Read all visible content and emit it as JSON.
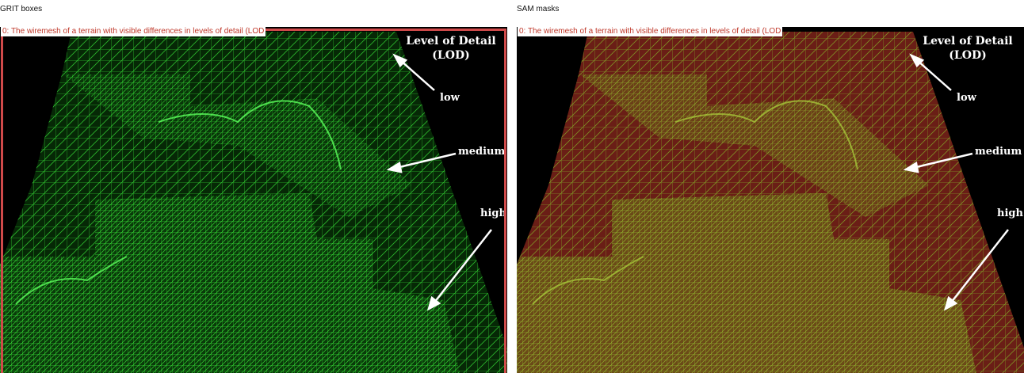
{
  "panels": [
    {
      "title": "GRIT boxes",
      "caption": "0: The wiremesh of a terrain with visible differences in levels of detail (LOD",
      "annotations": {
        "heading_line1": "Level of Detail",
        "heading_line2": "(LOD)",
        "low": "low",
        "medium": "medium",
        "high": "high"
      }
    },
    {
      "title": "SAM masks",
      "caption": "0: The wiremesh of a terrain with visible differences in levels of detail (LOD",
      "annotations": {
        "heading_line1": "Level of Detail",
        "heading_line2": "(LOD)",
        "low": "low",
        "medium": "medium",
        "high": "high"
      }
    }
  ],
  "colors": {
    "mesh_green": "#2bd12b",
    "box_red": "#d04a4a",
    "mask_tint": "#9c3020",
    "background": "#000000"
  }
}
